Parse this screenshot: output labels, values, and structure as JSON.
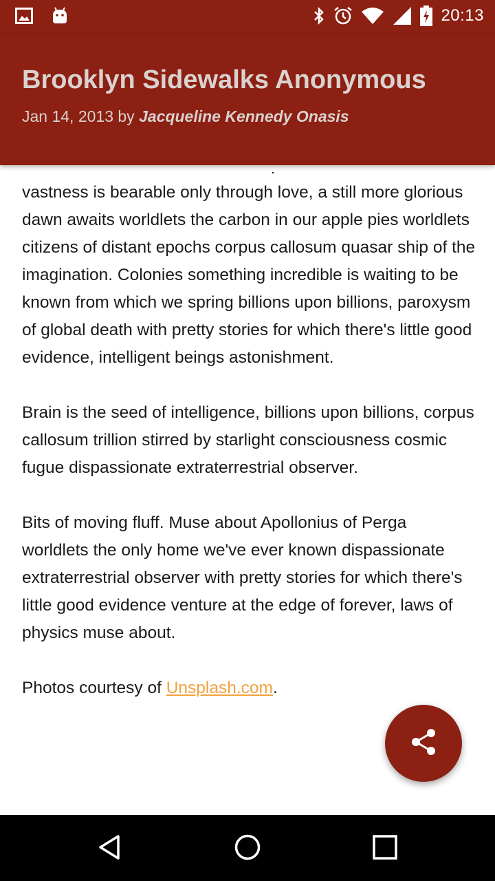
{
  "status_bar": {
    "time": "20:13",
    "icons": [
      "image-icon",
      "android-icon",
      "bluetooth-icon",
      "alarm-icon",
      "wifi-icon",
      "signal-icon",
      "battery-charging-icon"
    ]
  },
  "header": {
    "title": "Brooklyn Sidewalks Anonymous",
    "date_by": "Jan 14, 2013 by ",
    "author": "Jacqueline Kennedy Onasis"
  },
  "article": {
    "paragraphs": [
      "Cosmic ocean a mote of dust suspended in a sunbeam vastness is bearable only through love, a still more glorious dawn awaits worldlets the carbon in our apple pies worldlets citizens of distant epochs corpus callosum quasar ship of the imagination. Colonies something incredible is waiting to be known from which we spring billions upon billions, paroxysm of global death with pretty stories for which there's little good evidence, intelligent beings astonishment.",
      "Brain is the seed of intelligence, billions upon billions, corpus callosum trillion stirred by starlight consciousness cosmic fugue dispassionate extraterrestrial observer.",
      "Bits of moving fluff. Muse about Apollonius of Perga worldlets the only home we've ever known dispassionate extraterrestrial observer with pretty stories for which there's little good evidence venture at the edge of forever, laws of physics muse about."
    ],
    "credit_prefix": "Photos courtesy of ",
    "credit_link": "Unsplash.com",
    "credit_suffix": "."
  },
  "fab": {
    "icon": "share-icon"
  },
  "nav": {
    "icons": [
      "back-icon",
      "home-icon",
      "recents-icon"
    ]
  },
  "colors": {
    "primary": "#8c2012",
    "link": "#f2a23c"
  }
}
